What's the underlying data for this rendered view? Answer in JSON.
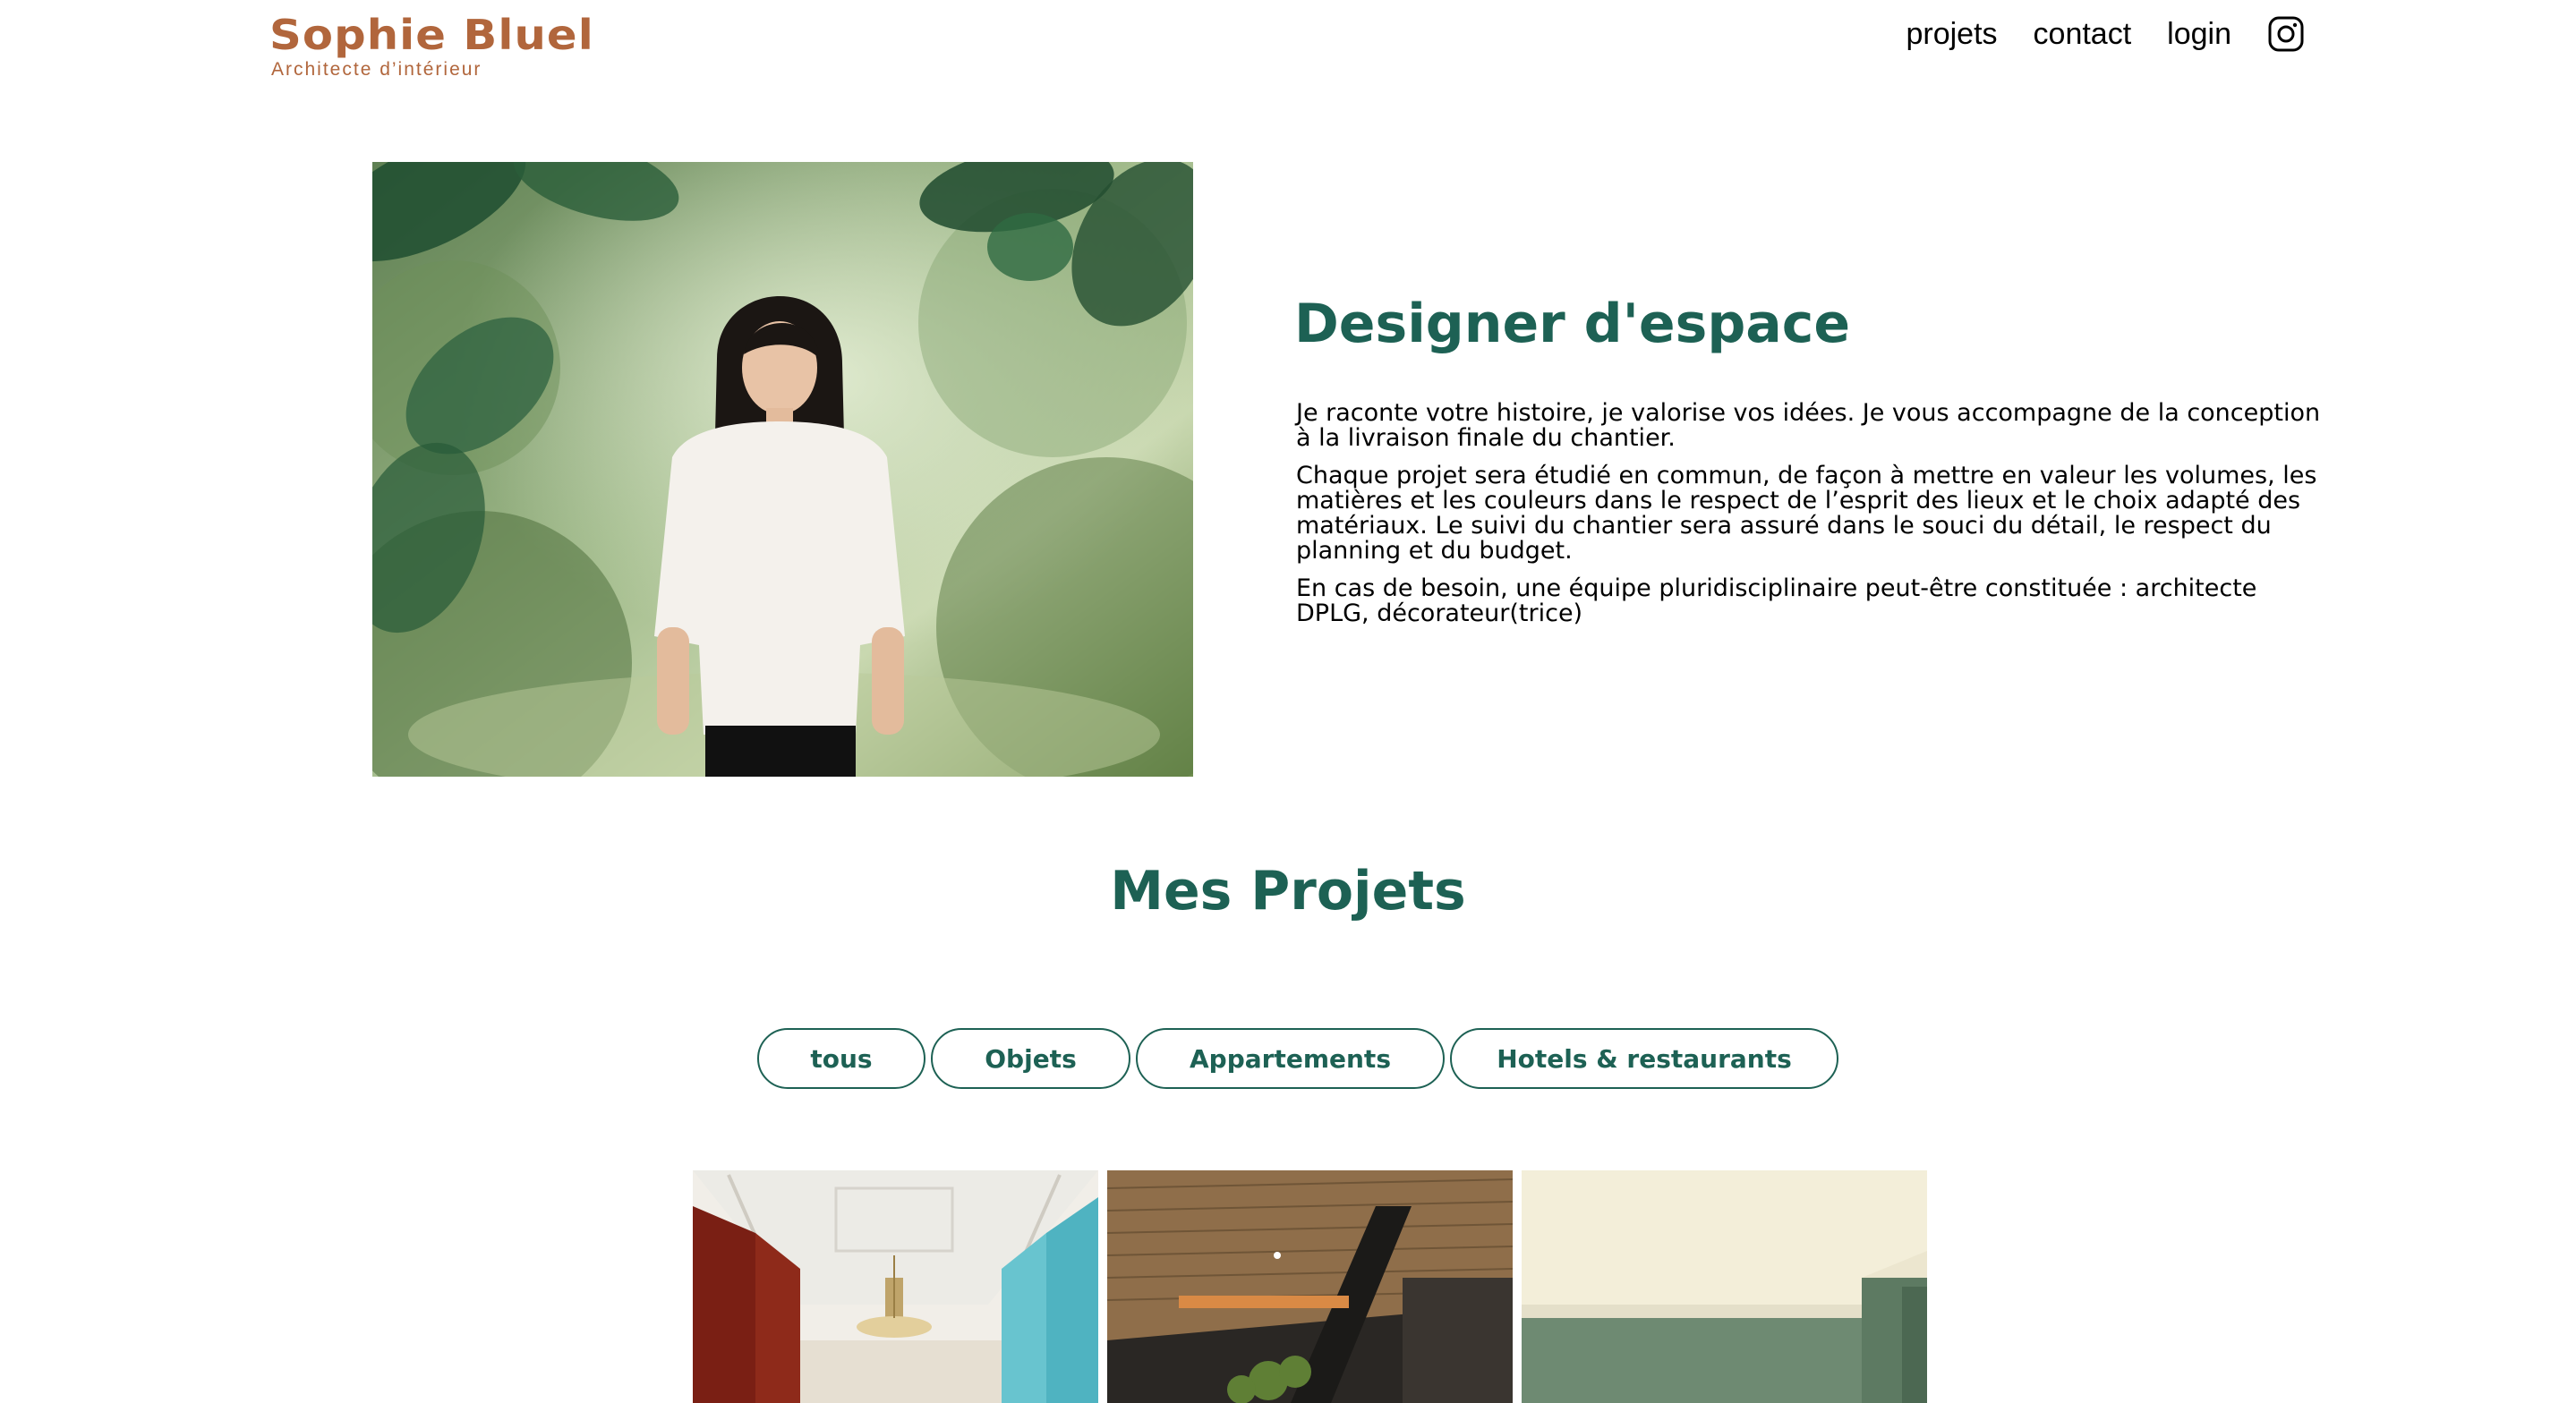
{
  "header": {
    "brand_name": "Sophie Bluel",
    "brand_tagline": "Architecte d’intérieur",
    "nav": [
      {
        "label": "projets"
      },
      {
        "label": "contact"
      },
      {
        "label": "login"
      }
    ],
    "social_icon": "instagram-icon"
  },
  "intro": {
    "title": "Designer d'espace",
    "paragraphs": [
      "Je raconte votre histoire, je valorise vos idées. Je vous accompagne de la conception à la livraison finale du chantier.",
      "Chaque projet sera étudié en commun, de façon à mettre en valeur les volumes, les matières et les couleurs dans le respect de l’esprit des lieux et le choix adapté des matériaux. Le suivi du chantier sera assuré dans le souci du détail, le respect du planning et du budget.",
      "En cas de besoin, une équipe pluridisciplinaire peut-être constituée : architecte DPLG, décorateur(trice)"
    ]
  },
  "projects": {
    "title": "Mes Projets",
    "filters": [
      {
        "label": "tous"
      },
      {
        "label": "Objets"
      },
      {
        "label": "Appartements"
      },
      {
        "label": "Hotels & restaurants"
      }
    ]
  },
  "colors": {
    "brand": "#B1663C",
    "accent": "#1D6154",
    "background": "#FFFFFF",
    "text": "#000000"
  }
}
